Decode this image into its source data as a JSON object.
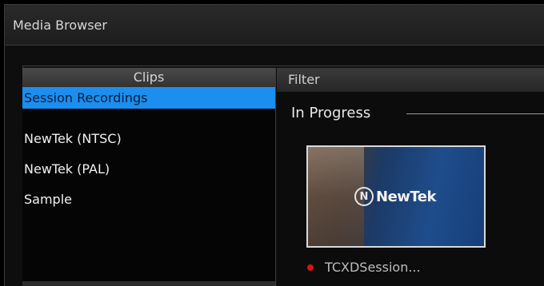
{
  "window": {
    "title": "Media Browser"
  },
  "clips": {
    "header": "Clips",
    "items": [
      {
        "label": "Session Recordings",
        "selected": true
      },
      {
        "label": "NewTek (NTSC)",
        "selected": false
      },
      {
        "label": "NewTek (PAL)",
        "selected": false
      },
      {
        "label": "Sample",
        "selected": false
      }
    ]
  },
  "filter": {
    "label": "Filter"
  },
  "section": {
    "title": "In Progress"
  },
  "thumbnail": {
    "logo_text": "NewTek",
    "logo_mark": "N",
    "status": "recording",
    "status_color": "#e01010",
    "name": "TCXDSession..."
  },
  "colors": {
    "accent": "#1b8ef0"
  }
}
